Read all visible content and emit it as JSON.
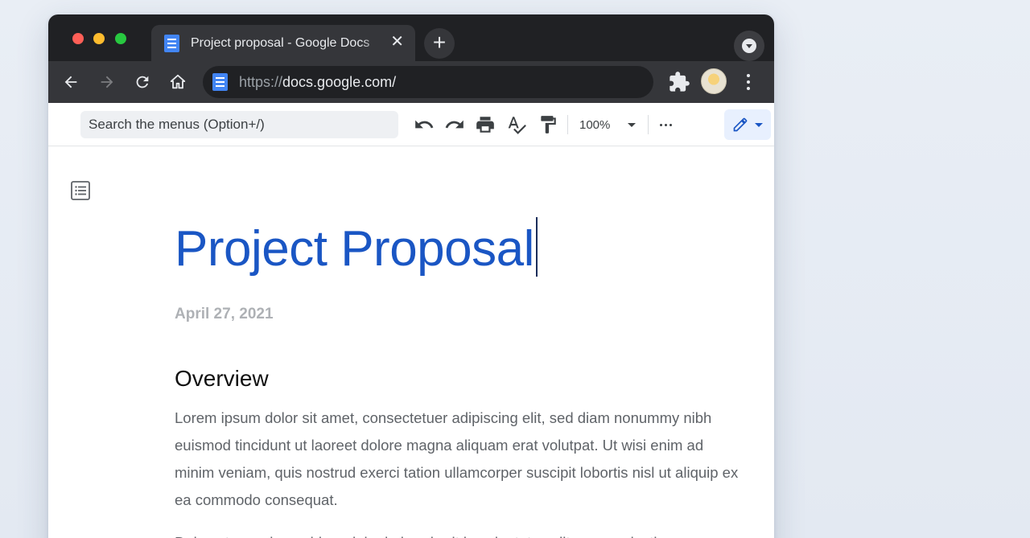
{
  "browser": {
    "tab": {
      "title": "Project proposal - Google Docs",
      "close": "✕"
    },
    "new_tab": "+",
    "url_prefix": "https://",
    "url_host": "docs.google.com/"
  },
  "docs_toolbar": {
    "search_placeholder": "Search the menus (Option+/)",
    "zoom": "100%"
  },
  "document": {
    "title": "Project Proposal",
    "date": "April 27, 2021",
    "heading": "Overview",
    "paragraphs": [
      "Lorem ipsum dolor sit amet, consectetuer adipiscing elit, sed diam nonummy nibh euismod tincidunt ut laoreet dolore magna aliquam erat volutpat. Ut wisi enim ad minim veniam, quis nostrud exerci tation ullamcorper suscipit lobortis nisl ut aliquip ex ea commodo consequat.",
      "Duis autem vel eum iriure dolor in hendrerit in vulputate velit esse molestie"
    ]
  },
  "colors": {
    "title_blue": "#1a56c4",
    "chrome_dark": "#202124",
    "chrome_toolbar": "#35363a",
    "docs_blue": "#4285f4"
  },
  "icons": {
    "nav": [
      "back-arrow-icon",
      "forward-arrow-icon",
      "reload-icon",
      "home-icon"
    ],
    "toolbar": [
      "undo-icon",
      "redo-icon",
      "print-icon",
      "spellcheck-icon",
      "paint-format-icon",
      "more-icon",
      "pencil-icon"
    ],
    "other": [
      "extensions-icon",
      "outline-icon",
      "docs-favicon-icon"
    ]
  }
}
